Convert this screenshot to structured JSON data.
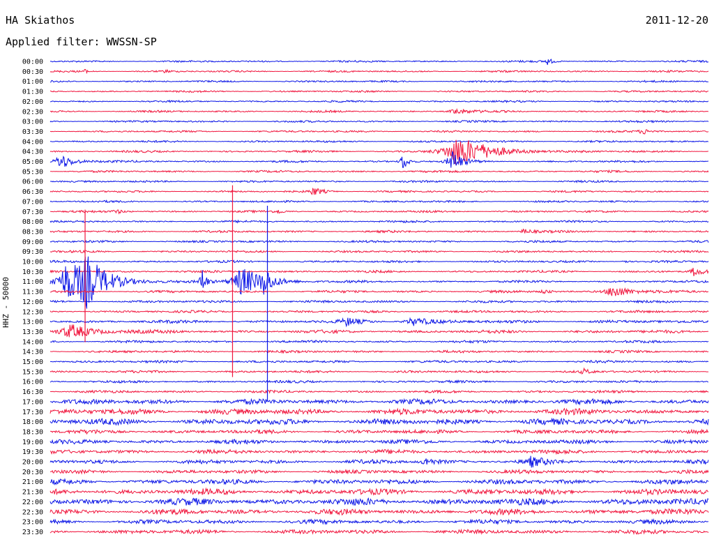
{
  "header": {
    "station": "HA Skiathos",
    "date": "2011-12-20",
    "filter": "Applied filter: WWSSN-SP",
    "channel": "HHZ - 50000"
  },
  "colors": {
    "trace_a": "#0a14e6",
    "trace_b": "#f0143c",
    "text": "#000000",
    "background": "#ffffff"
  },
  "chart_data": {
    "type": "line",
    "chart_kind": "helicorder",
    "rows": [
      "00:00",
      "00:30",
      "01:00",
      "01:30",
      "02:00",
      "02:30",
      "03:00",
      "03:30",
      "04:00",
      "04:30",
      "05:00",
      "05:30",
      "06:00",
      "06:30",
      "07:00",
      "07:30",
      "08:00",
      "08:30",
      "09:00",
      "09:30",
      "10:00",
      "10:30",
      "11:00",
      "11:30",
      "12:00",
      "12:30",
      "13:00",
      "13:30",
      "14:00",
      "14:30",
      "15:00",
      "15:30",
      "16:00",
      "16:30",
      "17:00",
      "17:30",
      "18:00",
      "18:30",
      "19:00",
      "19:30",
      "20:00",
      "20:30",
      "21:00",
      "21:30",
      "22:00",
      "22:30",
      "23:00",
      "23:30"
    ],
    "row_noise": [
      1.5,
      1.5,
      1.5,
      1.5,
      1.5,
      1.6,
      1.6,
      1.6,
      1.6,
      1.7,
      1.7,
      1.7,
      1.6,
      1.6,
      1.6,
      1.7,
      1.7,
      1.8,
      1.8,
      1.8,
      1.8,
      1.9,
      1.9,
      2.0,
      2.0,
      2.0,
      2.5,
      2.6,
      2.0,
      2.0,
      2.0,
      2.0,
      2.0,
      2.1,
      4.2,
      4.8,
      5.0,
      3.2,
      3.4,
      3.3,
      3.3,
      3.0,
      4.0,
      4.8,
      5.5,
      4.5,
      3.5,
      3.5
    ],
    "events": [
      {
        "row": 1,
        "t": 0.05,
        "amp": 4,
        "dur": 0.006
      },
      {
        "row": 1,
        "t": 0.175,
        "amp": 3,
        "dur": 0.005
      },
      {
        "row": 0,
        "t": 0.755,
        "amp": 5,
        "dur": 0.008
      },
      {
        "row": 5,
        "t": 0.615,
        "amp": 5,
        "dur": 0.02
      },
      {
        "row": 7,
        "t": 0.9,
        "amp": 4,
        "dur": 0.012
      },
      {
        "row": 9,
        "t": 0.618,
        "amp": 22,
        "dur": 0.05
      },
      {
        "row": 10,
        "t": 0.61,
        "amp": 16,
        "dur": 0.015
      },
      {
        "row": 10,
        "t": 0.015,
        "amp": 12,
        "dur": 0.02
      },
      {
        "row": 10,
        "t": 0.535,
        "amp": 14,
        "dur": 0.008
      },
      {
        "row": 13,
        "t": 0.4,
        "amp": 6,
        "dur": 0.015
      },
      {
        "row": 15,
        "t": 0.1,
        "amp": 3,
        "dur": 0.012
      },
      {
        "row": 15,
        "t": 0.345,
        "amp": 3,
        "dur": 0.008
      },
      {
        "row": 17,
        "t": 0.72,
        "amp": 4,
        "dur": 0.012
      },
      {
        "row": 20,
        "t": 0.87,
        "amp": 4,
        "dur": 0.006
      },
      {
        "row": 21,
        "t": 0.978,
        "amp": 7,
        "dur": 0.012
      },
      {
        "row": 22,
        "t": 0.025,
        "amp": 28,
        "dur": 0.04
      },
      {
        "row": 22,
        "t": 0.055,
        "amp": 28,
        "dur": 0.03
      },
      {
        "row": 22,
        "t": 0.23,
        "amp": 24,
        "dur": 0.006
      },
      {
        "row": 22,
        "t": 0.29,
        "amp": 22,
        "dur": 0.035
      },
      {
        "row": 22,
        "t": 0.325,
        "amp": 16,
        "dur": 0.01
      },
      {
        "row": 23,
        "t": 0.855,
        "amp": 10,
        "dur": 0.025
      },
      {
        "row": 23,
        "t": 0.75,
        "amp": 4,
        "dur": 0.01
      },
      {
        "row": 26,
        "t": 0.45,
        "amp": 5,
        "dur": 0.02
      },
      {
        "row": 26,
        "t": 0.55,
        "amp": 6,
        "dur": 0.03
      },
      {
        "row": 27,
        "t": 0.03,
        "amp": 10,
        "dur": 0.04
      },
      {
        "row": 31,
        "t": 0.81,
        "amp": 4,
        "dur": 0.008
      },
      {
        "row": 40,
        "t": 0.57,
        "amp": 6,
        "dur": 0.015
      },
      {
        "row": 40,
        "t": 0.73,
        "amp": 6,
        "dur": 0.02
      }
    ],
    "spikes": [
      {
        "row": 19,
        "t": 0.053,
        "up": 60,
        "down": 130
      },
      {
        "row": 19,
        "t": 0.277,
        "up": 95,
        "down": 180
      },
      {
        "row": 20,
        "t": 0.33,
        "up": 80,
        "down": 200
      }
    ]
  }
}
